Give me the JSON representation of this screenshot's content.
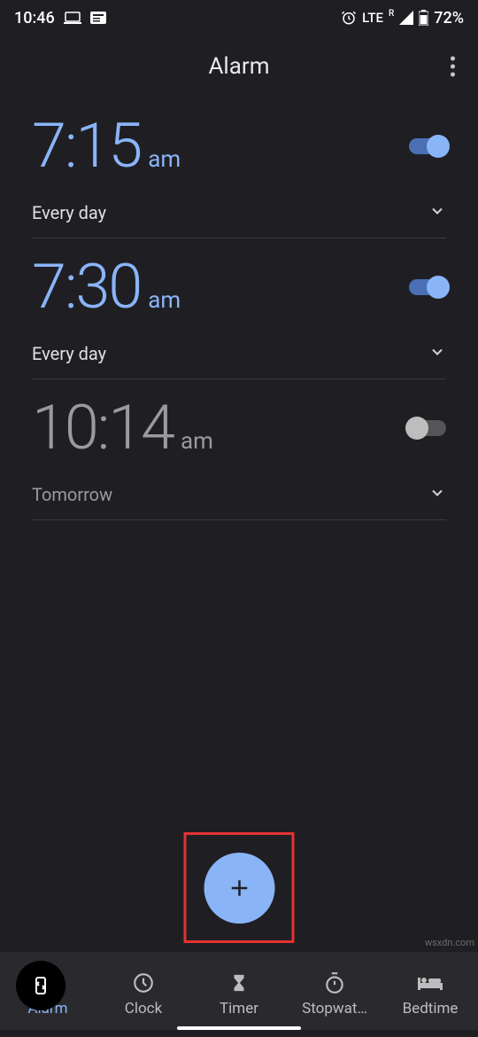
{
  "statusBar": {
    "time": "10:46",
    "network": "LTE",
    "networkSuper": "R",
    "battery": "72%"
  },
  "appBar": {
    "title": "Alarm"
  },
  "alarms": [
    {
      "time": "7:15",
      "ampm": "am",
      "schedule": "Every day",
      "enabled": true
    },
    {
      "time": "7:30",
      "ampm": "am",
      "schedule": "Every day",
      "enabled": true
    },
    {
      "time": "10:14",
      "ampm": "am",
      "schedule": "Tomorrow",
      "enabled": false
    }
  ],
  "bottomNav": [
    {
      "key": "alarm",
      "label": "Alarm",
      "active": true
    },
    {
      "key": "clock",
      "label": "Clock",
      "active": false
    },
    {
      "key": "timer",
      "label": "Timer",
      "active": false
    },
    {
      "key": "stopwatch",
      "label": "Stopwat…",
      "active": false
    },
    {
      "key": "bedtime",
      "label": "Bedtime",
      "active": false
    }
  ],
  "watermark": "wsxdn.com"
}
